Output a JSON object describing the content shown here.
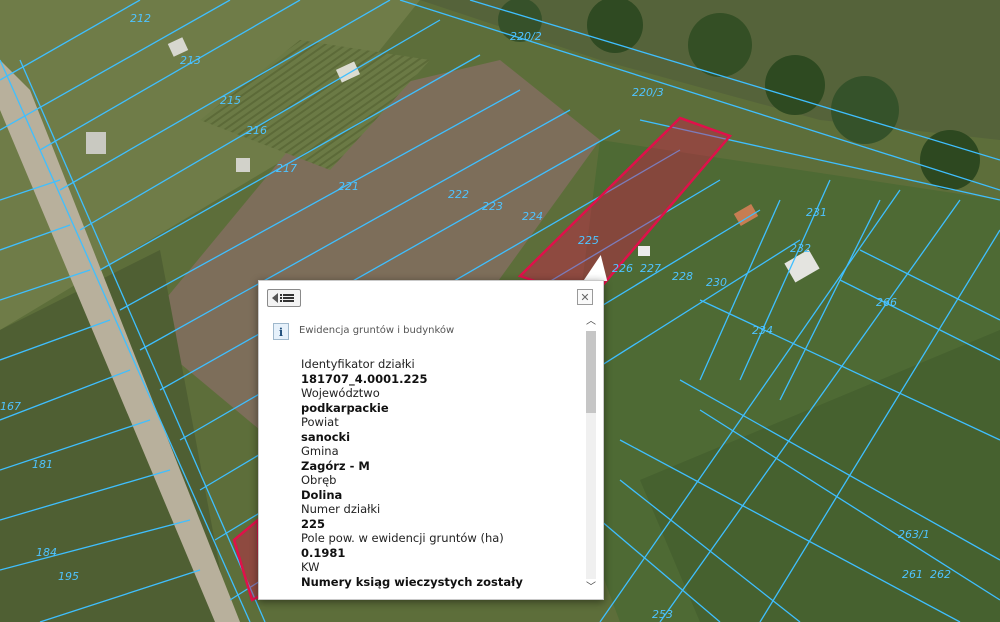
{
  "map": {
    "plot_labels": [
      "212",
      "213",
      "215",
      "216",
      "217",
      "221",
      "222",
      "223",
      "224",
      "225",
      "226",
      "227",
      "228",
      "230",
      "231",
      "232",
      "234",
      "266",
      "220/2",
      "220/3",
      "167",
      "181",
      "184",
      "195",
      "253",
      "263/1",
      "261",
      "262"
    ]
  },
  "popup": {
    "back_icon": "list-back-icon",
    "close_icon": "close-icon",
    "info_icon": "i",
    "layer_title": "Ewidencja gruntów i budynków",
    "attributes": [
      {
        "label": "Identyfikator działki",
        "value": "181707_4.0001.225"
      },
      {
        "label": "Województwo",
        "value": "podkarpackie"
      },
      {
        "label": "Powiat",
        "value": "sanocki"
      },
      {
        "label": "Gmina",
        "value": "Zagórz - M"
      },
      {
        "label": "Obręb",
        "value": "Dolina"
      },
      {
        "label": "Numer działki",
        "value": "225"
      },
      {
        "label": "Pole pow. w ewidencji gruntów (ha)",
        "value": "0.1981"
      },
      {
        "label": "KW",
        "value": "Numery ksiąg wieczystych zostały"
      }
    ]
  },
  "colors": {
    "parcel_line": "#3fbfff",
    "selected_parcel": "#e0104a",
    "label": "#4fc3ff"
  }
}
